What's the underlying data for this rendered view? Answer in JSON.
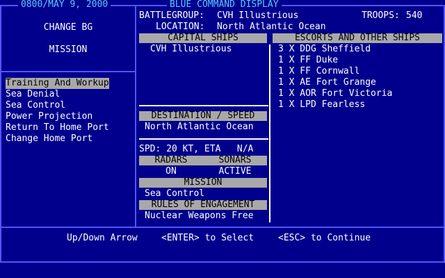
{
  "header": {
    "datetime": "0800/MAY  9, 2000",
    "title": "BLUE  COMMAND DISPLAY"
  },
  "left_panel": {
    "change_bg": "CHANGE BG",
    "mission": "MISSION",
    "menu": [
      {
        "label": "Training And Workup",
        "selected": true
      },
      {
        "label": "Sea Denial",
        "selected": false
      },
      {
        "label": "Sea Control",
        "selected": false
      },
      {
        "label": "Power Projection",
        "selected": false
      },
      {
        "label": "Return To Home Port",
        "selected": false
      },
      {
        "label": "Change Home Port",
        "selected": false
      }
    ]
  },
  "info": {
    "battlegroup_label": "BATTLEGROUP:",
    "battlegroup_value": "CVH Illustrious",
    "troops_label": "TROOPS:",
    "troops_value": "540",
    "location_label": "LOCATION:",
    "location_value": "North Atlantic Ocean"
  },
  "capital_ships": {
    "header": "CAPITAL SHIPS",
    "items": [
      "CVH Illustrious"
    ]
  },
  "escorts": {
    "header": "ESCORTS AND OTHER SHIPS",
    "items": [
      "3 X DDG Sheffield",
      "1 X FF Duke",
      "1 X FF Cornwall",
      "1 X AE Fort Grange",
      "1 X AOR Fort Victoria",
      "1 X LPD Fearless"
    ]
  },
  "destination": {
    "header": "DESTINATION / SPEED",
    "value": "North Atlantic Ocean",
    "spd": "SPD: 20 KT, ETA   N/A"
  },
  "sensors": {
    "radars_header": "RADARS",
    "sonars_header": "SONARS",
    "radars_value": "ON",
    "sonars_value": "ACTIVE"
  },
  "mission_box": {
    "header": "MISSION",
    "value": "Sea Control"
  },
  "roe": {
    "header": "RULES OF ENGAGEMENT",
    "value": "Nuclear Weapons Free"
  },
  "footer": {
    "nav": "Up/Down Arrow",
    "enter": "<ENTER> to Select",
    "esc": "<ESC> to Continue"
  },
  "colors": {
    "background": "#00008c",
    "frame": "#5454fc",
    "highlight": "#a8a8a8",
    "title": "#5cc7ff"
  }
}
